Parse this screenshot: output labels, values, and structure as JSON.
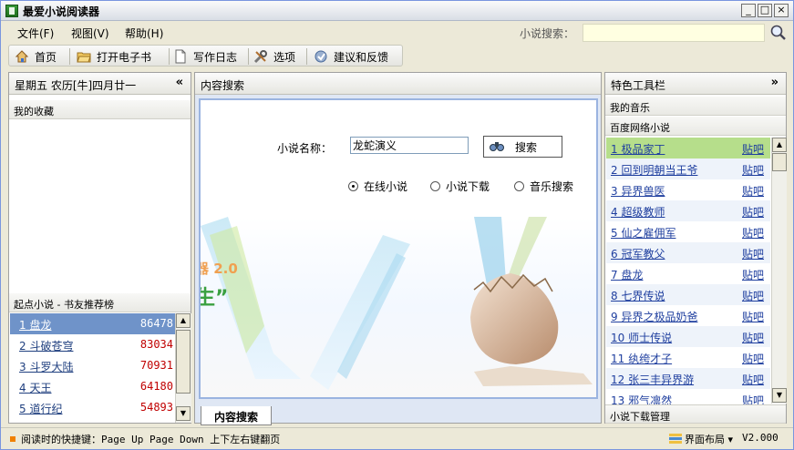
{
  "window": {
    "title": "最爱小说阅读器",
    "minimize": "_",
    "maximize": "□",
    "close": "×"
  },
  "menu": {
    "file": "文件(F)",
    "view": "视图(V)",
    "help": "帮助(H)"
  },
  "top_search": {
    "label": "小说搜索：",
    "value": ""
  },
  "toolbar": {
    "home": "首页",
    "open_ebook": "打开电子书",
    "write_diary": "写作日志",
    "options": "选项",
    "feedback": "建议和反馈"
  },
  "left_panel": {
    "date": "星期五  农历[牛]四月廿一",
    "collapse_arrow": "«",
    "favorites_title": "我的收藏",
    "rank_title": "起点小说 - 书友推荐榜",
    "rank_items": [
      {
        "label": "1 盘龙",
        "value": "86478"
      },
      {
        "label": "2 斗破苍穹",
        "value": "83034"
      },
      {
        "label": "3 斗罗大陆",
        "value": "70931"
      },
      {
        "label": "4 天王",
        "value": "64180"
      },
      {
        "label": "5 道行纪",
        "value": "54893"
      }
    ]
  },
  "center_panel": {
    "title": "内容搜索",
    "novel_name_label": "小说名称：",
    "novel_name_value": "龙蛇演义",
    "search_button": "搜索",
    "radio_online": "在线小说",
    "radio_download": "小说下载",
    "radio_music": "音乐搜索",
    "banner_version": "器 2.0",
    "banner_slogan": "生”",
    "bottom_tab": "内容搜索"
  },
  "right_panel": {
    "title": "特色工具栏",
    "expand_arrow": "»",
    "my_music": "我的音乐",
    "baidu_title": "百度网络小说",
    "tie_label": "贴吧",
    "novels": [
      "1 极品家丁",
      "2 回到明朝当王爷",
      "3 异界兽医",
      "4 超级教师",
      "5 仙之雇佣军",
      "6 冠军教父",
      "7 盘龙",
      "8 七界传说",
      "9 异界之极品奶爸",
      "10 师士传说",
      "11 纨绔才子",
      "12 张三丰异界游",
      "13 邪气凛然"
    ],
    "download_manager": "小说下载管理"
  },
  "status": {
    "shortcut_text": "阅读时的快捷键：Page Up Page Down 上下左右键翻页",
    "layout": "界面布局 ▾",
    "version": "V2.000"
  },
  "colors": {
    "selected_rank": "#6f93c9",
    "selected_novel": "#b6de8b",
    "rank_value": "#c00000",
    "link": "#1f3f9f"
  }
}
